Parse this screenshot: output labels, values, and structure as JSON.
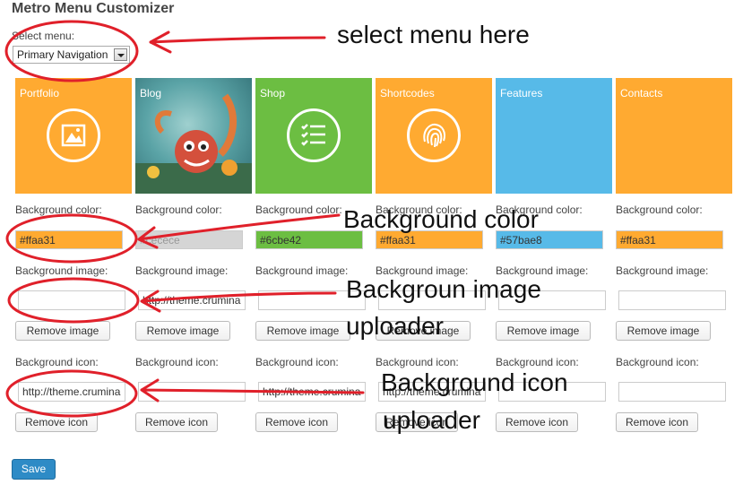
{
  "title": "Metro Menu Customizer",
  "select": {
    "label": "Select menu:",
    "value": "Primary Navigation"
  },
  "tiles": [
    {
      "name": "Portfolio",
      "color": "#ffaa31",
      "color_value": "#ffaa31",
      "image_value": "",
      "icon_value": "http://theme.crumina",
      "icon": "image-icon"
    },
    {
      "name": "Blog",
      "color": "#d5d5d5",
      "color_value": "#cecece",
      "image_value": "http://theme.crumina",
      "icon_value": "",
      "icon": "blog-photo"
    },
    {
      "name": "Shop",
      "color": "#6cbe42",
      "color_value": "#6cbe42",
      "image_value": "",
      "icon_value": "http://theme.crumina",
      "icon": "list-icon"
    },
    {
      "name": "Shortcodes",
      "color": "#ffaa31",
      "color_value": "#ffaa31",
      "image_value": "",
      "icon_value": "http://theme.crumina",
      "icon": "fingerprint-icon"
    },
    {
      "name": "Features",
      "color": "#57bae8",
      "color_value": "#57bae8",
      "image_value": "",
      "icon_value": "",
      "icon": ""
    },
    {
      "name": "Contacts",
      "color": "#ffaa31",
      "color_value": "#ffaa31",
      "image_value": "",
      "icon_value": "",
      "icon": ""
    }
  ],
  "labels": {
    "bg_color": "Background color:",
    "bg_image": "Background image:",
    "bg_icon": "Background icon:",
    "remove_image": "Remove image",
    "remove_icon": "Remove icon"
  },
  "save_label": "Save",
  "annotations": {
    "select_menu": "select menu here",
    "bg_color": "Background color",
    "bg_image_1": "Backgroun image",
    "bg_image_2": "uploader",
    "bg_icon_1": "Background icon",
    "bg_icon_2": "uploader"
  },
  "annotation_color": "#e0202a"
}
